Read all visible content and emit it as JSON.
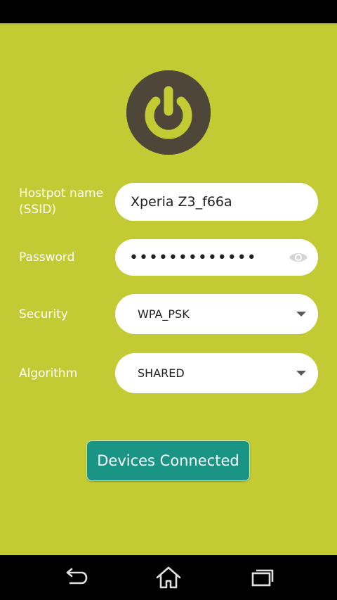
{
  "form": {
    "ssid": {
      "label": "Hostpot name\n(SSID)",
      "label_line1": "Hostpot name",
      "label_line2": "(SSID)",
      "value": "Xperia Z3_f66a"
    },
    "password": {
      "label": "Password",
      "value": "•••••••••••••"
    },
    "security": {
      "label": "Security",
      "value": "WPA_PSK"
    },
    "algorithm": {
      "label": "Algorithm",
      "value": "SHARED"
    }
  },
  "actions": {
    "devices_connected": "Devices Connected"
  },
  "icons": {
    "power": "power-icon",
    "eye": "eye-icon",
    "back": "back-icon",
    "home": "home-icon",
    "recents": "recents-icon"
  },
  "colors": {
    "background": "#c2cb34",
    "power_circle": "#4e4639",
    "accent_button": "#1a9585",
    "field_bg": "#ffffff"
  }
}
